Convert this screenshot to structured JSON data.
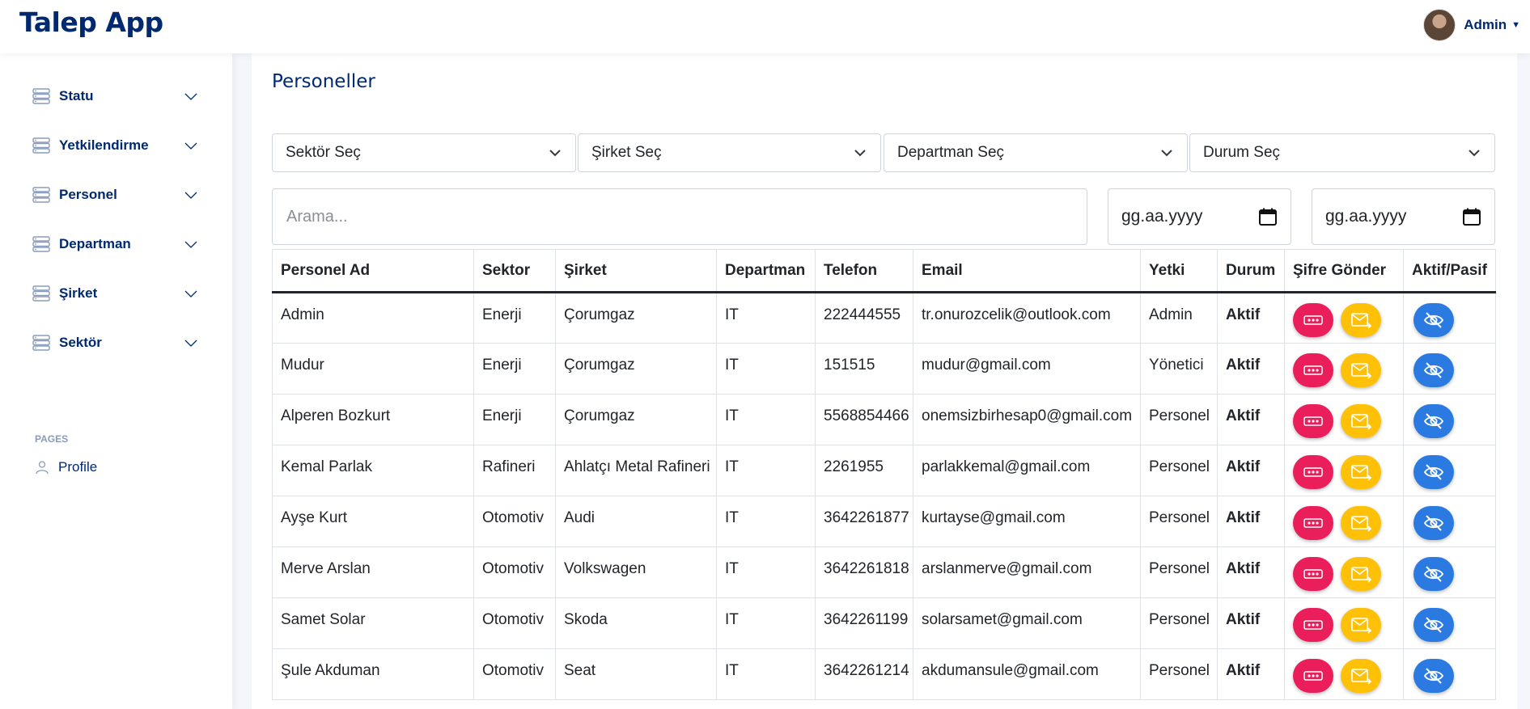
{
  "app": {
    "title": "Talep App"
  },
  "user": {
    "name": "Admin"
  },
  "sidebar": {
    "items": [
      {
        "label": "Statu"
      },
      {
        "label": "Yetkilendirme"
      },
      {
        "label": "Personel"
      },
      {
        "label": "Departman"
      },
      {
        "label": "Şirket"
      },
      {
        "label": "Sektör"
      }
    ],
    "section_label": "PAGES",
    "profile_label": "Profile"
  },
  "page": {
    "title": "Personeller"
  },
  "filters": {
    "sector": "Sektör Seç",
    "company": "Şirket Seç",
    "department": "Departman Seç",
    "status": "Durum Seç",
    "search_placeholder": "Arama...",
    "date_start": "gg.aa.yyyy",
    "date_end": "gg.aa.yyyy"
  },
  "table": {
    "headers": [
      "Personel Ad",
      "Sektor",
      "Şirket",
      "Departman",
      "Telefon",
      "Email",
      "Yetki",
      "Durum",
      "Şifre Gönder",
      "Aktif/Pasif"
    ],
    "rows": [
      {
        "name": "Admin",
        "sector": "Enerji",
        "company": "Çorumgaz",
        "department": "IT",
        "phone": "222444555",
        "email": "tr.onurozcelik@outlook.com",
        "role": "Admin",
        "status": "Aktif"
      },
      {
        "name": "Mudur",
        "sector": "Enerji",
        "company": "Çorumgaz",
        "department": "IT",
        "phone": "151515",
        "email": "mudur@gmail.com",
        "role": "Yönetici",
        "status": "Aktif"
      },
      {
        "name": "Alperen Bozkurt",
        "sector": "Enerji",
        "company": "Çorumgaz",
        "department": "IT",
        "phone": "5568854466",
        "email": "onemsizbirhesap0@gmail.com",
        "role": "Personel",
        "status": "Aktif"
      },
      {
        "name": "Kemal Parlak",
        "sector": "Rafineri",
        "company": "Ahlatçı Metal Rafineri",
        "department": "IT",
        "phone": "2261955",
        "email": "parlakkemal@gmail.com",
        "role": "Personel",
        "status": "Aktif"
      },
      {
        "name": "Ayşe Kurt",
        "sector": "Otomotiv",
        "company": "Audi",
        "department": "IT",
        "phone": "3642261877",
        "email": "kurtayse@gmail.com",
        "role": "Personel",
        "status": "Aktif"
      },
      {
        "name": "Merve Arslan",
        "sector": "Otomotiv",
        "company": "Volkswagen",
        "department": "IT",
        "phone": "3642261818",
        "email": "arslanmerve@gmail.com",
        "role": "Personel",
        "status": "Aktif"
      },
      {
        "name": "Samet Solar",
        "sector": "Otomotiv",
        "company": "Skoda",
        "department": "IT",
        "phone": "3642261199",
        "email": "solarsamet@gmail.com",
        "role": "Personel",
        "status": "Aktif"
      },
      {
        "name": "Şule Akduman",
        "sector": "Otomotiv",
        "company": "Seat",
        "department": "IT",
        "phone": "3642261214",
        "email": "akdumansule@gmail.com",
        "role": "Personel",
        "status": "Aktif"
      }
    ]
  },
  "colors": {
    "brand": "#012970",
    "send_password_button": "#eb1e5c",
    "send_mail_button": "#ffc107",
    "toggle_active_button": "#2a7ae2"
  },
  "icons": {
    "menu_item": "server-icon",
    "chevron": "chevron-down-icon",
    "profile": "person-icon",
    "password": "password-dots-icon",
    "mail": "envelope-arrow-icon",
    "visibility": "eye-slash-icon",
    "calendar": "calendar-icon"
  }
}
